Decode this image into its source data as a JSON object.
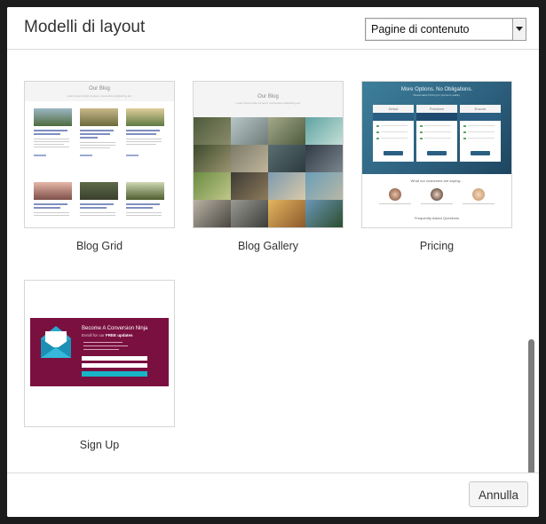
{
  "dialog": {
    "title": "Modelli di layout",
    "select": {
      "value": "Pagine di contenuto"
    }
  },
  "templates": [
    {
      "label": "Blog Grid",
      "thumb": {
        "title": "Our Blog",
        "subtitle": "Lorem ipsum dolor sit amet, consectetur adipiscing elit."
      }
    },
    {
      "label": "Blog Gallery",
      "thumb": {
        "title": "Our Blog",
        "subtitle": "Lorem ipsum dolor sit amet, consectetur adipiscing elit."
      }
    },
    {
      "label": "Pricing",
      "thumb": {
        "title": "More Options. No Obligations.",
        "subtitle": "Reasonable Pricing for premium quality.",
        "plans": [
          "Debut",
          "Premiere",
          "Encore"
        ],
        "testimonials_heading": "What our customers are saying...",
        "faq_heading": "Frequently Asked Questions"
      }
    },
    {
      "label": "Sign Up",
      "thumb": {
        "title": "Become A Conversion Ninja",
        "subtitle_prefix": "Enroll for our",
        "subtitle_strong": "FREE updates"
      }
    }
  ],
  "footer": {
    "cancel_label": "Annulla"
  },
  "colors": {
    "signup_bg": "#7a1040",
    "signup_button": "#18b4c6",
    "pricing_bg": "#2c5f7d"
  },
  "icons": [
    "chevron-down-icon",
    "envelope-icon"
  ]
}
